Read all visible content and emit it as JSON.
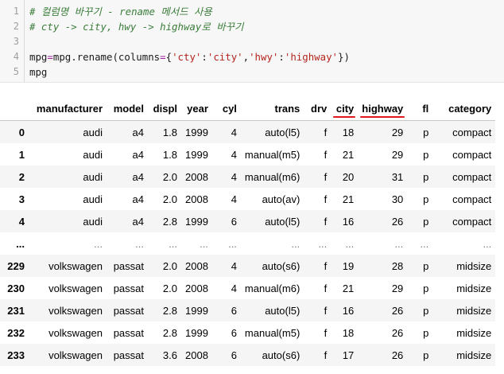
{
  "code": {
    "lines": [
      {
        "num": "1",
        "comment": "# 컬럼명 바꾸기 - rename 메서드 사용"
      },
      {
        "num": "2",
        "comment": "# cty -> city, hwy -> highway로 바꾸기"
      },
      {
        "num": "3"
      },
      {
        "num": "4",
        "tokens": [
          {
            "t": "v",
            "s": "mpg"
          },
          {
            "t": "op",
            "s": "="
          },
          {
            "t": "v",
            "s": "mpg.rename(columns"
          },
          {
            "t": "op",
            "s": "="
          },
          {
            "t": "v",
            "s": "{"
          },
          {
            "t": "str",
            "s": "'cty'"
          },
          {
            "t": "v",
            "s": ":"
          },
          {
            "t": "str",
            "s": "'city'"
          },
          {
            "t": "v",
            "s": ","
          },
          {
            "t": "str",
            "s": "'hwy'"
          },
          {
            "t": "v",
            "s": ":"
          },
          {
            "t": "str",
            "s": "'highway'"
          },
          {
            "t": "v",
            "s": "})"
          }
        ]
      },
      {
        "num": "5",
        "tokens": [
          {
            "t": "v",
            "s": "mpg"
          }
        ]
      }
    ]
  },
  "table": {
    "columns": [
      "manufacturer",
      "model",
      "displ",
      "year",
      "cyl",
      "trans",
      "drv",
      "city",
      "highway",
      "fl",
      "category"
    ],
    "highlight_color": "#e0191e",
    "rows": [
      {
        "index": "0",
        "cells": [
          "audi",
          "a4",
          "1.8",
          "1999",
          "4",
          "auto(l5)",
          "f",
          "18",
          "29",
          "p",
          "compact"
        ]
      },
      {
        "index": "1",
        "cells": [
          "audi",
          "a4",
          "1.8",
          "1999",
          "4",
          "manual(m5)",
          "f",
          "21",
          "29",
          "p",
          "compact"
        ]
      },
      {
        "index": "2",
        "cells": [
          "audi",
          "a4",
          "2.0",
          "2008",
          "4",
          "manual(m6)",
          "f",
          "20",
          "31",
          "p",
          "compact"
        ]
      },
      {
        "index": "3",
        "cells": [
          "audi",
          "a4",
          "2.0",
          "2008",
          "4",
          "auto(av)",
          "f",
          "21",
          "30",
          "p",
          "compact"
        ]
      },
      {
        "index": "4",
        "cells": [
          "audi",
          "a4",
          "2.8",
          "1999",
          "6",
          "auto(l5)",
          "f",
          "16",
          "26",
          "p",
          "compact"
        ]
      },
      {
        "index": "...",
        "cells": [
          "...",
          "...",
          "...",
          "...",
          "...",
          "...",
          "...",
          "...",
          "...",
          "...",
          "..."
        ]
      },
      {
        "index": "229",
        "cells": [
          "volkswagen",
          "passat",
          "2.0",
          "2008",
          "4",
          "auto(s6)",
          "f",
          "19",
          "28",
          "p",
          "midsize"
        ]
      },
      {
        "index": "230",
        "cells": [
          "volkswagen",
          "passat",
          "2.0",
          "2008",
          "4",
          "manual(m6)",
          "f",
          "21",
          "29",
          "p",
          "midsize"
        ]
      },
      {
        "index": "231",
        "cells": [
          "volkswagen",
          "passat",
          "2.8",
          "1999",
          "6",
          "auto(l5)",
          "f",
          "16",
          "26",
          "p",
          "midsize"
        ]
      },
      {
        "index": "232",
        "cells": [
          "volkswagen",
          "passat",
          "2.8",
          "1999",
          "6",
          "manual(m5)",
          "f",
          "18",
          "26",
          "p",
          "midsize"
        ]
      },
      {
        "index": "233",
        "cells": [
          "volkswagen",
          "passat",
          "3.6",
          "2008",
          "6",
          "auto(s6)",
          "f",
          "17",
          "26",
          "p",
          "midsize"
        ]
      }
    ]
  }
}
